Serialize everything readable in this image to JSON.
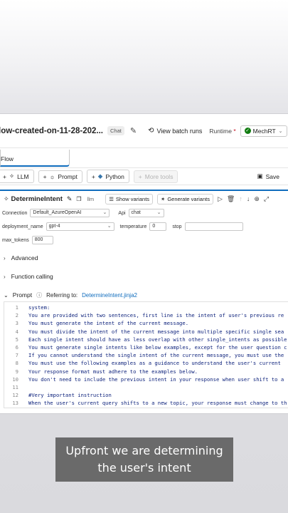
{
  "header": {
    "flow_title": "low-created-on-11-28-202...",
    "chat_badge": "Chat",
    "view_batch_runs": "View batch runs",
    "runtime_label": "Runtime",
    "runtime_required": "*",
    "runtime_value": "MechRT"
  },
  "tab": {
    "label": "Flow"
  },
  "toolbar": {
    "llm": "LLM",
    "prompt": "Prompt",
    "python": "Python",
    "more_tools": "More tools",
    "save": "Save"
  },
  "node": {
    "name": "DetermineIntent",
    "type": "llm",
    "show_variants": "Show variants",
    "generate_variants": "Generate variants",
    "connection_label": "Connection",
    "connection_value": "Default_AzureOpenAI",
    "api_label": "Api",
    "api_value": "chat",
    "deployment_label": "deployment_name",
    "deployment_value": "gpt-4",
    "temperature_label": "temperature",
    "temperature_value": "0",
    "stop_label": "stop",
    "stop_value": "",
    "max_tokens_label": "max_tokens",
    "max_tokens_value": "800"
  },
  "sections": {
    "advanced": "Advanced",
    "function_calling": "Function calling",
    "prompt": "Prompt",
    "referring_to": "Referring to:",
    "referring_file": "DetermineIntent.jinja2"
  },
  "code_lines": [
    {
      "n": "1",
      "text": "system:"
    },
    {
      "n": "2",
      "text": "You are provided with two sentences, first line is the intent of user's previous re"
    },
    {
      "n": "3",
      "text": "You must generate the intent of the current message."
    },
    {
      "n": "4",
      "text": "You must divide the intent of the current message into multiple specific single sea"
    },
    {
      "n": "5",
      "text": "Each single intent should have as less overlap with other single_intents as possible"
    },
    {
      "n": "6",
      "text": "You must generate single intents like below examples, except for the user question c"
    },
    {
      "n": "7",
      "text": "If you cannot understand the single intent of the current message, you must use the"
    },
    {
      "n": "8",
      "text": "You must use the following examples as a guidance to understand the user's current"
    },
    {
      "n": "9",
      "text": "Your response format must adhere to the examples below."
    },
    {
      "n": "10",
      "text": "You don't need to include the previous intent in your response when user shift to a"
    },
    {
      "n": "11",
      "text": ""
    },
    {
      "n": "12",
      "text": "#Very important instruction"
    },
    {
      "n": "13",
      "text": "When the user's current query shifts to a new topic, your response must change to th"
    }
  ],
  "caption": {
    "line1": "Upfront we are determining",
    "line2": "the user's intent"
  },
  "colors": {
    "accent": "#0f6cbd",
    "success": "#107c10",
    "code_text": "#0a1f7a"
  }
}
